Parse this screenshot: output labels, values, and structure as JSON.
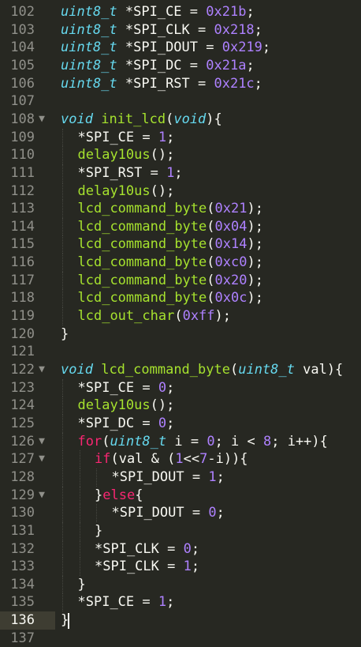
{
  "colors": {
    "background": "#272822",
    "type": "#66d9ef",
    "function": "#a6e22e",
    "number": "#ae81ff",
    "keyword": "#f92672",
    "plain": "#f8f8f2",
    "gutter": "#90908a"
  },
  "current_line": 136,
  "lines": [
    {
      "n": "102",
      "fold": false,
      "indent": 0,
      "tokens": [
        [
          "ty",
          "uint8_t"
        ],
        [
          "pl",
          " *SPI_CE = "
        ],
        [
          "num",
          "0x21b"
        ],
        [
          "pl",
          ";"
        ]
      ]
    },
    {
      "n": "103",
      "fold": false,
      "indent": 0,
      "tokens": [
        [
          "ty",
          "uint8_t"
        ],
        [
          "pl",
          " *SPI_CLK = "
        ],
        [
          "num",
          "0x218"
        ],
        [
          "pl",
          ";"
        ]
      ]
    },
    {
      "n": "104",
      "fold": false,
      "indent": 0,
      "tokens": [
        [
          "ty",
          "uint8_t"
        ],
        [
          "pl",
          " *SPI_DOUT = "
        ],
        [
          "num",
          "0x219"
        ],
        [
          "pl",
          ";"
        ]
      ]
    },
    {
      "n": "105",
      "fold": false,
      "indent": 0,
      "tokens": [
        [
          "ty",
          "uint8_t"
        ],
        [
          "pl",
          " *SPI_DC = "
        ],
        [
          "num",
          "0x21a"
        ],
        [
          "pl",
          ";"
        ]
      ]
    },
    {
      "n": "106",
      "fold": false,
      "indent": 0,
      "tokens": [
        [
          "ty",
          "uint8_t"
        ],
        [
          "pl",
          " *SPI_RST = "
        ],
        [
          "num",
          "0x21c"
        ],
        [
          "pl",
          ";"
        ]
      ]
    },
    {
      "n": "107",
      "fold": false,
      "indent": 0,
      "tokens": []
    },
    {
      "n": "108",
      "fold": true,
      "indent": 0,
      "tokens": [
        [
          "ty",
          "void"
        ],
        [
          "pl",
          " "
        ],
        [
          "fn",
          "init_lcd"
        ],
        [
          "pl",
          "("
        ],
        [
          "ty",
          "void"
        ],
        [
          "pl",
          "){"
        ]
      ]
    },
    {
      "n": "109",
      "fold": false,
      "indent": 1,
      "tokens": [
        [
          "pl",
          "*SPI_CE = "
        ],
        [
          "num",
          "1"
        ],
        [
          "pl",
          ";"
        ]
      ]
    },
    {
      "n": "110",
      "fold": false,
      "indent": 1,
      "tokens": [
        [
          "fn",
          "delay10us"
        ],
        [
          "pl",
          "();"
        ]
      ]
    },
    {
      "n": "111",
      "fold": false,
      "indent": 1,
      "tokens": [
        [
          "pl",
          "*SPI_RST = "
        ],
        [
          "num",
          "1"
        ],
        [
          "pl",
          ";"
        ]
      ]
    },
    {
      "n": "112",
      "fold": false,
      "indent": 1,
      "tokens": [
        [
          "fn",
          "delay10us"
        ],
        [
          "pl",
          "();"
        ]
      ]
    },
    {
      "n": "113",
      "fold": false,
      "indent": 1,
      "tokens": [
        [
          "fn",
          "lcd_command_byte"
        ],
        [
          "pl",
          "("
        ],
        [
          "num",
          "0x21"
        ],
        [
          "pl",
          ");"
        ]
      ]
    },
    {
      "n": "114",
      "fold": false,
      "indent": 1,
      "tokens": [
        [
          "fn",
          "lcd_command_byte"
        ],
        [
          "pl",
          "("
        ],
        [
          "num",
          "0x04"
        ],
        [
          "pl",
          ");"
        ]
      ]
    },
    {
      "n": "115",
      "fold": false,
      "indent": 1,
      "tokens": [
        [
          "fn",
          "lcd_command_byte"
        ],
        [
          "pl",
          "("
        ],
        [
          "num",
          "0x14"
        ],
        [
          "pl",
          ");"
        ]
      ]
    },
    {
      "n": "116",
      "fold": false,
      "indent": 1,
      "tokens": [
        [
          "fn",
          "lcd_command_byte"
        ],
        [
          "pl",
          "("
        ],
        [
          "num",
          "0xc0"
        ],
        [
          "pl",
          ");"
        ]
      ]
    },
    {
      "n": "117",
      "fold": false,
      "indent": 1,
      "tokens": [
        [
          "fn",
          "lcd_command_byte"
        ],
        [
          "pl",
          "("
        ],
        [
          "num",
          "0x20"
        ],
        [
          "pl",
          ");"
        ]
      ]
    },
    {
      "n": "118",
      "fold": false,
      "indent": 1,
      "tokens": [
        [
          "fn",
          "lcd_command_byte"
        ],
        [
          "pl",
          "("
        ],
        [
          "num",
          "0x0c"
        ],
        [
          "pl",
          ");"
        ]
      ]
    },
    {
      "n": "119",
      "fold": false,
      "indent": 1,
      "tokens": [
        [
          "fn",
          "lcd_out_char"
        ],
        [
          "pl",
          "("
        ],
        [
          "num",
          "0xff"
        ],
        [
          "pl",
          ");"
        ]
      ]
    },
    {
      "n": "120",
      "fold": false,
      "indent": 0,
      "tokens": [
        [
          "pl",
          "}"
        ]
      ]
    },
    {
      "n": "121",
      "fold": false,
      "indent": 0,
      "tokens": []
    },
    {
      "n": "122",
      "fold": true,
      "indent": 0,
      "tokens": [
        [
          "ty",
          "void"
        ],
        [
          "pl",
          " "
        ],
        [
          "fn",
          "lcd_command_byte"
        ],
        [
          "pl",
          "("
        ],
        [
          "ty",
          "uint8_t"
        ],
        [
          "pl",
          " val){"
        ]
      ]
    },
    {
      "n": "123",
      "fold": false,
      "indent": 1,
      "tokens": [
        [
          "pl",
          "*SPI_CE = "
        ],
        [
          "num",
          "0"
        ],
        [
          "pl",
          ";"
        ]
      ]
    },
    {
      "n": "124",
      "fold": false,
      "indent": 1,
      "tokens": [
        [
          "fn",
          "delay10us"
        ],
        [
          "pl",
          "();"
        ]
      ]
    },
    {
      "n": "125",
      "fold": false,
      "indent": 1,
      "tokens": [
        [
          "pl",
          "*SPI_DC = "
        ],
        [
          "num",
          "0"
        ],
        [
          "pl",
          ";"
        ]
      ]
    },
    {
      "n": "126",
      "fold": true,
      "indent": 1,
      "tokens": [
        [
          "kw",
          "for"
        ],
        [
          "pl",
          "("
        ],
        [
          "ty",
          "uint8_t"
        ],
        [
          "pl",
          " i = "
        ],
        [
          "num",
          "0"
        ],
        [
          "pl",
          "; i < "
        ],
        [
          "num",
          "8"
        ],
        [
          "pl",
          "; i++){"
        ]
      ]
    },
    {
      "n": "127",
      "fold": true,
      "indent": 2,
      "tokens": [
        [
          "kw",
          "if"
        ],
        [
          "pl",
          "(val & ("
        ],
        [
          "num",
          "1"
        ],
        [
          "pl",
          "<<"
        ],
        [
          "num",
          "7"
        ],
        [
          "pl",
          "-i)){"
        ]
      ]
    },
    {
      "n": "128",
      "fold": false,
      "indent": 3,
      "tokens": [
        [
          "pl",
          "*SPI_DOUT = "
        ],
        [
          "num",
          "1"
        ],
        [
          "pl",
          ";"
        ]
      ]
    },
    {
      "n": "129",
      "fold": true,
      "indent": 2,
      "tokens": [
        [
          "pl",
          "}"
        ],
        [
          "kw",
          "else"
        ],
        [
          "pl",
          "{"
        ]
      ]
    },
    {
      "n": "130",
      "fold": false,
      "indent": 3,
      "tokens": [
        [
          "pl",
          "*SPI_DOUT = "
        ],
        [
          "num",
          "0"
        ],
        [
          "pl",
          ";"
        ]
      ]
    },
    {
      "n": "131",
      "fold": false,
      "indent": 2,
      "tokens": [
        [
          "pl",
          "}"
        ]
      ]
    },
    {
      "n": "132",
      "fold": false,
      "indent": 2,
      "tokens": [
        [
          "pl",
          "*SPI_CLK = "
        ],
        [
          "num",
          "0"
        ],
        [
          "pl",
          ";"
        ]
      ]
    },
    {
      "n": "133",
      "fold": false,
      "indent": 2,
      "tokens": [
        [
          "pl",
          "*SPI_CLK = "
        ],
        [
          "num",
          "1"
        ],
        [
          "pl",
          ";"
        ]
      ]
    },
    {
      "n": "134",
      "fold": false,
      "indent": 1,
      "tokens": [
        [
          "pl",
          "}"
        ]
      ]
    },
    {
      "n": "135",
      "fold": false,
      "indent": 1,
      "tokens": [
        [
          "pl",
          "*SPI_CE = "
        ],
        [
          "num",
          "1"
        ],
        [
          "pl",
          ";"
        ]
      ]
    },
    {
      "n": "136",
      "fold": false,
      "indent": 0,
      "tokens": [
        [
          "pl",
          "}"
        ]
      ]
    },
    {
      "n": "137",
      "fold": false,
      "indent": 0,
      "tokens": []
    }
  ],
  "fold_icon": "fold-triangle-down-icon"
}
